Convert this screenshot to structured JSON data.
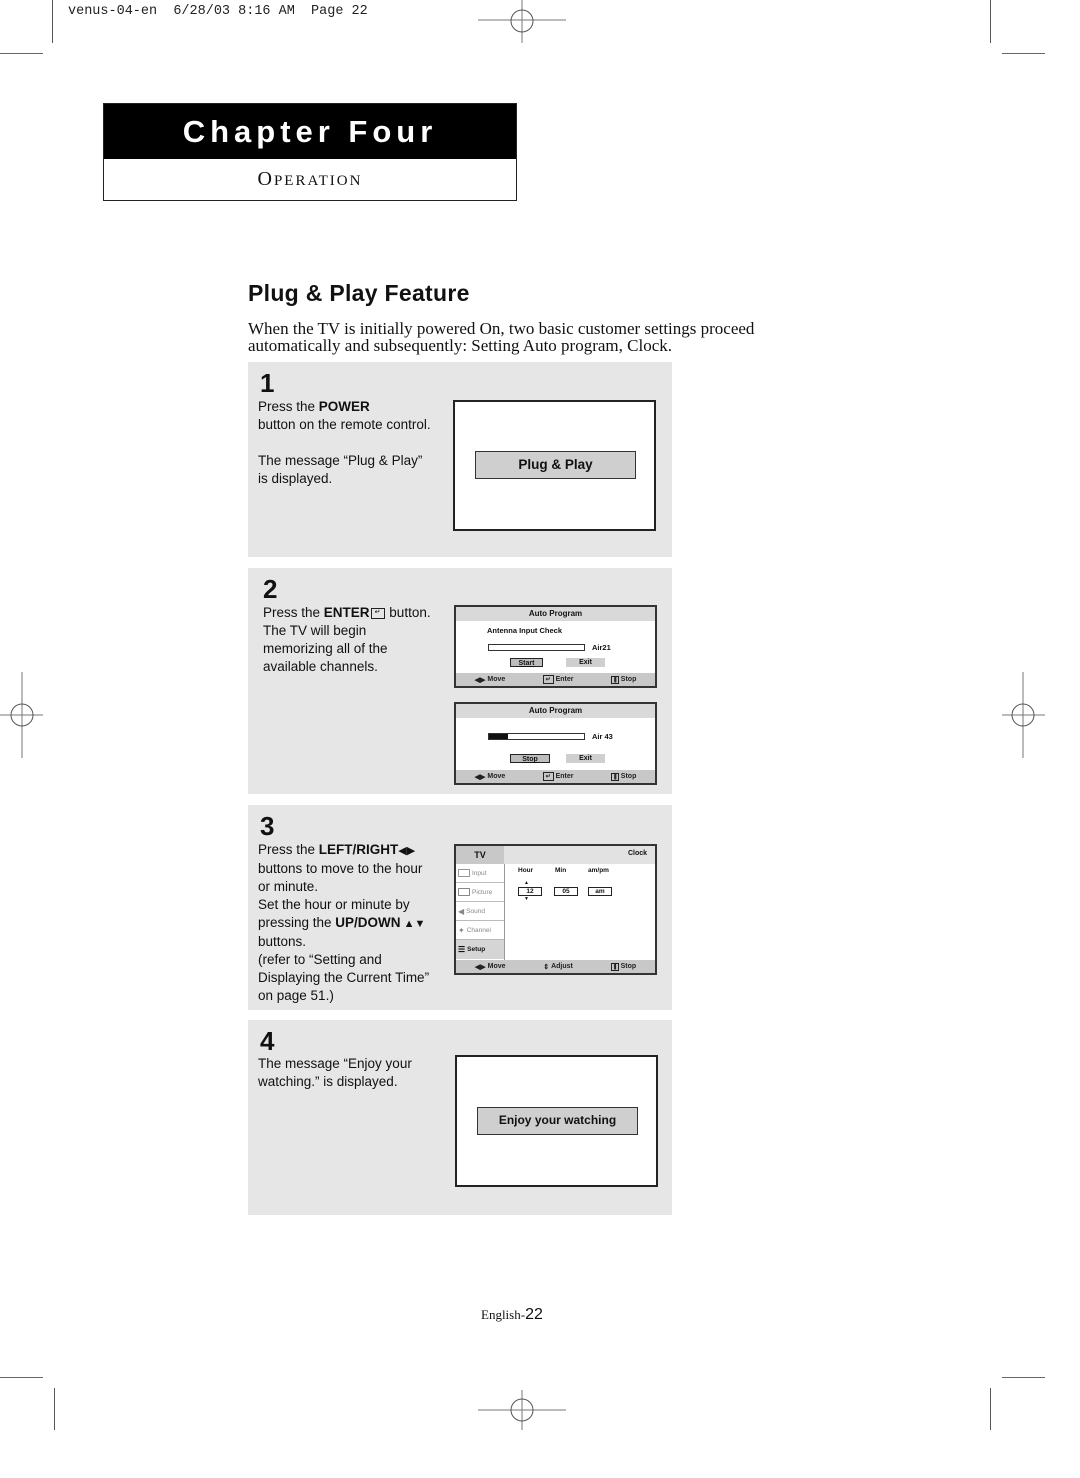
{
  "slug": {
    "text": "venus-04-en  6/28/03 8:16 AM  Page 22"
  },
  "chapter": {
    "title": "Chapter Four",
    "subtitle_initial": "O",
    "subtitle_rest": "PERATION"
  },
  "section": {
    "title": "Plug & Play Feature",
    "intro": "When the TV is initially powered On, two basic customer settings proceed automatically and subsequently: Setting Auto program, Clock."
  },
  "steps": [
    {
      "number": "1",
      "lines": [
        {
          "pre": "Press the ",
          "bold": "POWER",
          "post": ""
        },
        {
          "pre": "button on the remote control.",
          "bold": "",
          "post": ""
        },
        {
          "pre": "",
          "bold": "",
          "post": ""
        },
        {
          "pre": "The message “Plug & Play”",
          "bold": "",
          "post": ""
        },
        {
          "pre": "is displayed.",
          "bold": "",
          "post": ""
        }
      ],
      "screen_message": "Plug & Play"
    },
    {
      "number": "2",
      "lines": [
        {
          "pre": "Press the ",
          "bold": "ENTER",
          "post": " button."
        },
        {
          "pre": "The TV will begin",
          "bold": "",
          "post": ""
        },
        {
          "pre": "memorizing all of the",
          "bold": "",
          "post": ""
        },
        {
          "pre": "available channels.",
          "bold": "",
          "post": ""
        }
      ],
      "osd_screens": [
        {
          "title": "Auto Program",
          "status_label": "Antenna Input Check",
          "channel": "Air21",
          "progress": 0,
          "buttons": [
            {
              "label": "Start",
              "selected": true
            },
            {
              "label": "Exit",
              "selected": false
            }
          ],
          "footer": [
            {
              "icon": "left-right-arrows",
              "label": "Move"
            },
            {
              "icon": "enter-key",
              "label": "Enter"
            },
            {
              "icon": "menu-key",
              "label": "Stop"
            }
          ]
        },
        {
          "title": "Auto Program",
          "status_label": "",
          "channel": "Air 43",
          "progress": 0.2,
          "buttons": [
            {
              "label": "Stop",
              "selected": true
            },
            {
              "label": "Exit",
              "selected": false
            }
          ],
          "footer": [
            {
              "icon": "left-right-arrows",
              "label": "Move"
            },
            {
              "icon": "enter-key",
              "label": "Enter"
            },
            {
              "icon": "menu-key",
              "label": "Stop"
            }
          ]
        }
      ]
    },
    {
      "number": "3",
      "lines": [
        {
          "pre": "Press the ",
          "bold": "LEFT/RIGHT",
          "post": "◀▶"
        },
        {
          "pre": "buttons to move to the hour",
          "bold": "",
          "post": ""
        },
        {
          "pre": "or minute.",
          "bold": "",
          "post": ""
        },
        {
          "pre": "Set the hour or minute by",
          "bold": "",
          "post": ""
        },
        {
          "pre": "pressing the ",
          "bold": "UP/DOWN",
          "post": " ▲▼"
        },
        {
          "pre": "buttons.",
          "bold": "",
          "post": ""
        },
        {
          "pre": "(refer to “Setting and",
          "bold": "",
          "post": ""
        },
        {
          "pre": "Displaying the Current Time”",
          "bold": "",
          "post": ""
        },
        {
          "pre": "on page 51.)",
          "bold": "",
          "post": ""
        }
      ],
      "clock_osd": {
        "side_title": "TV",
        "header_title": "Clock",
        "menu": [
          {
            "icon": "input-icon",
            "label": "Input",
            "active": false
          },
          {
            "icon": "picture-icon",
            "label": "Picture",
            "active": false
          },
          {
            "icon": "sound-icon",
            "label": "Sound",
            "active": false
          },
          {
            "icon": "channel-icon",
            "label": "Channel",
            "active": false
          },
          {
            "icon": "setup-icon",
            "label": "Setup",
            "active": true
          }
        ],
        "columns": [
          "Hour",
          "Min",
          "am/pm"
        ],
        "values": [
          "12",
          "05",
          "am"
        ],
        "footer": [
          {
            "icon": "left-right-arrows",
            "label": "Move"
          },
          {
            "icon": "up-down-arrows",
            "label": "Adjust"
          },
          {
            "icon": "menu-key",
            "label": "Stop"
          }
        ]
      }
    },
    {
      "number": "4",
      "lines": [
        {
          "pre": "The message “Enjoy your",
          "bold": "",
          "post": ""
        },
        {
          "pre": "watching.” is displayed.",
          "bold": "",
          "post": ""
        }
      ],
      "screen_message": "Enjoy your watching"
    }
  ],
  "footer": {
    "label": "English-",
    "page": "22"
  }
}
